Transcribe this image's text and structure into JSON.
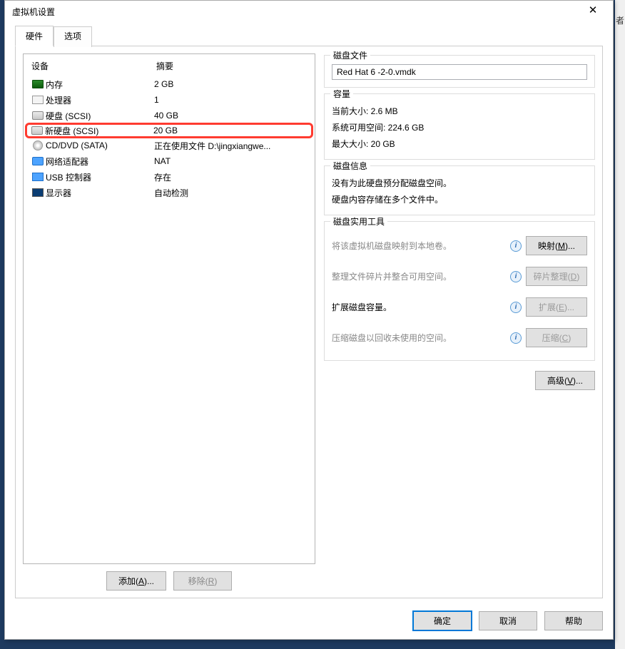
{
  "window": {
    "title": "虚拟机设置",
    "close": "✕"
  },
  "tabs": {
    "hardware": "硬件",
    "options": "选项"
  },
  "deviceList": {
    "header": {
      "device": "设备",
      "summary": "摘要"
    },
    "rows": [
      {
        "name": "内存",
        "summary": "2 GB"
      },
      {
        "name": "处理器",
        "summary": "1"
      },
      {
        "name": "硬盘 (SCSI)",
        "summary": "40 GB"
      },
      {
        "name": "新硬盘 (SCSI)",
        "summary": "20 GB"
      },
      {
        "name": "CD/DVD (SATA)",
        "summary": "正在使用文件 D:\\jingxiangwe..."
      },
      {
        "name": "网络适配器",
        "summary": "NAT"
      },
      {
        "name": "USB 控制器",
        "summary": "存在"
      },
      {
        "name": "显示器",
        "summary": "自动检测"
      }
    ]
  },
  "leftButtons": {
    "add": "添加(A)...",
    "remove": "移除(R)"
  },
  "diskFile": {
    "legend": "磁盘文件",
    "value": "Red Hat 6 -2-0.vmdk"
  },
  "capacity": {
    "legend": "容量",
    "currentSize": "当前大小: 2.6 MB",
    "freeSpace": "系统可用空间: 224.6 GB",
    "maxSize": "最大大小: 20 GB"
  },
  "diskInfo": {
    "legend": "磁盘信息",
    "line1": "没有为此硬盘预分配磁盘空间。",
    "line2": "硬盘内容存储在多个文件中。"
  },
  "utilities": {
    "legend": "磁盘实用工具",
    "map": {
      "text": "将该虚拟机磁盘映射到本地卷。",
      "btn": "映射(M)..."
    },
    "defrag": {
      "text": "整理文件碎片并整合可用空间。",
      "btn": "碎片整理(D)"
    },
    "expand": {
      "text": "扩展磁盘容量。",
      "btn": "扩展(E)..."
    },
    "compact": {
      "text": "压缩磁盘以回收未使用的空间。",
      "btn": "压缩(C)"
    }
  },
  "advanced": "高级(V)...",
  "footer": {
    "ok": "确定",
    "cancel": "取消",
    "help": "帮助"
  },
  "bgText": "者"
}
